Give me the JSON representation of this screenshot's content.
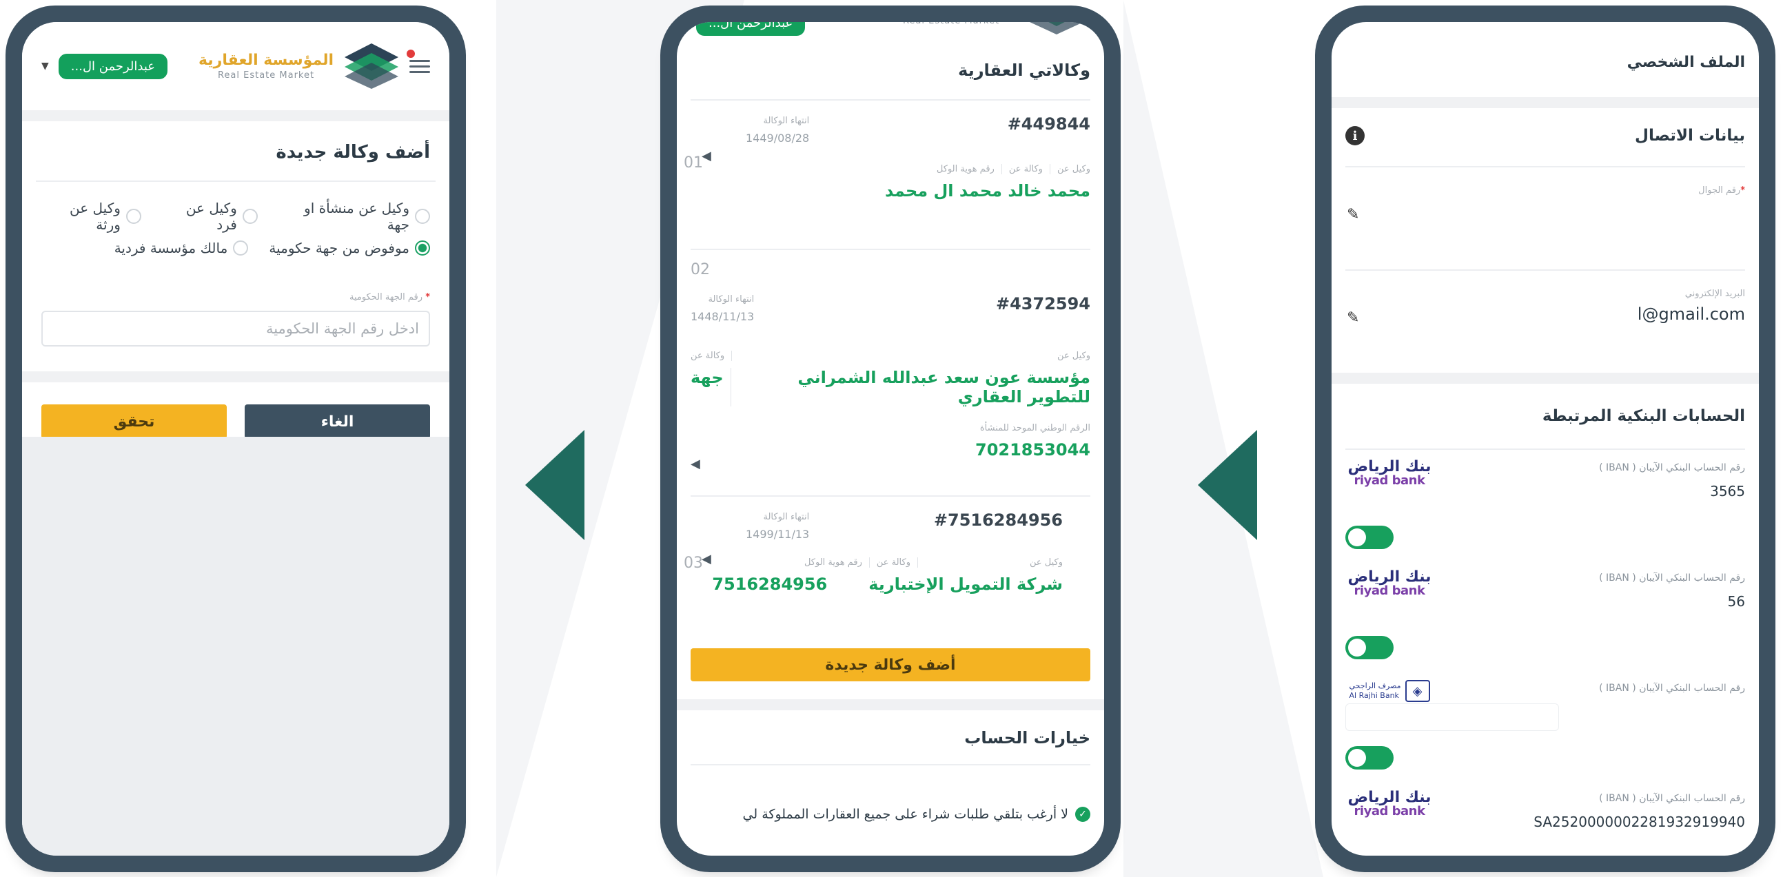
{
  "colors": {
    "phone_frame": "#3d5161",
    "brand_green": "#17a05d",
    "accent_yellow": "#f4b322",
    "arrow_teal": "#1f6b5f",
    "alert_red": "#e23b3b"
  },
  "header": {
    "brand_ar": "المؤسسة العقارية",
    "brand_en": "Real Estate Market",
    "user_name": "عبدالرحمن ال..."
  },
  "icons": {
    "menu": "hamburger-menu-icon",
    "logo": "real-estate-logo",
    "caret": "chevron-down-icon",
    "prev": "chevron-left-icon",
    "edit": "edit-icon",
    "info": "info-icon",
    "check": "checkmark-icon",
    "nav_arrow": "arrow-left-icon"
  },
  "add_agency": {
    "title": "أضف وكالة جديدة",
    "options": [
      "وكيل عن منشأة او جهة",
      "وكيل عن فرد",
      "وكيل عن ورثة",
      "موفوض من جهة حكومية",
      "مالك مؤسسة فردية"
    ],
    "selected_option": "موفوض من جهة حكومية",
    "field_label": "رقم الجهة الحكومية",
    "field_placeholder": "ادخل رقم الجهة الحكومية",
    "cancel_label": "الغاء",
    "verify_label": "تحقق"
  },
  "agencies": {
    "title": "وكالاتي العقارية",
    "end_label": "انتهاء الوكالة",
    "agent_for_label": "وكيل عن",
    "agency_for_label": "وكالة عن",
    "agent_id_label": "رقم هوية الوكل",
    "national_id_label": "الرقم الوطني الموحد للمنشأة",
    "items": [
      {
        "num": "01",
        "id": "#449844",
        "end_date": "1449/08/28",
        "agent_name": "محمد خالد محمد ال محمد",
        "agency_for": "",
        "agent_id": ""
      },
      {
        "num": "02",
        "id": "#4372594",
        "end_date": "1448/11/13",
        "agent_name": "مؤسسة عون سعد عبدالله الشمراني للتطوير العقاري",
        "agency_for": "جهة",
        "national_id": "7021853044"
      },
      {
        "num": "03",
        "id": "#7516284956",
        "end_date": "1499/11/13",
        "agent_name": "شركة التمويل الإختبارية",
        "agent_id": "7516284956"
      }
    ],
    "add_label": "أضف وكالة جديدة",
    "options_title": "خيارات الحساب",
    "checkbox_text": "لا أرغب بتلقي طلبات شراء على جميع العقارات المملوكة لي"
  },
  "profile": {
    "title": "الملف الشخصي",
    "contact_title": "بيانات الاتصال",
    "mobile_label": "رقم الجوال",
    "email_label": "البريد الإلكتروني",
    "email_value": "l@gmail.com",
    "banks_title": "الحسابات البنكية المرتبطة",
    "iban_label": "رقم الحساب البنكي الآيبان ( IBAN )",
    "riyad_ar": "بنك الرياض",
    "riyad_en": "riyad bank",
    "rajhi_ar": "مصرف الراجحي",
    "rajhi_en": "Al Rajhi Bank",
    "banks": [
      {
        "logo": "riyad",
        "iban": "3565",
        "enabled": true
      },
      {
        "logo": "riyad",
        "iban": "56",
        "enabled": true
      },
      {
        "logo": "rajhi",
        "iban": "",
        "enabled": true
      },
      {
        "logo": "riyad",
        "iban": "SA2520000002281932919940",
        "enabled": true
      }
    ]
  }
}
